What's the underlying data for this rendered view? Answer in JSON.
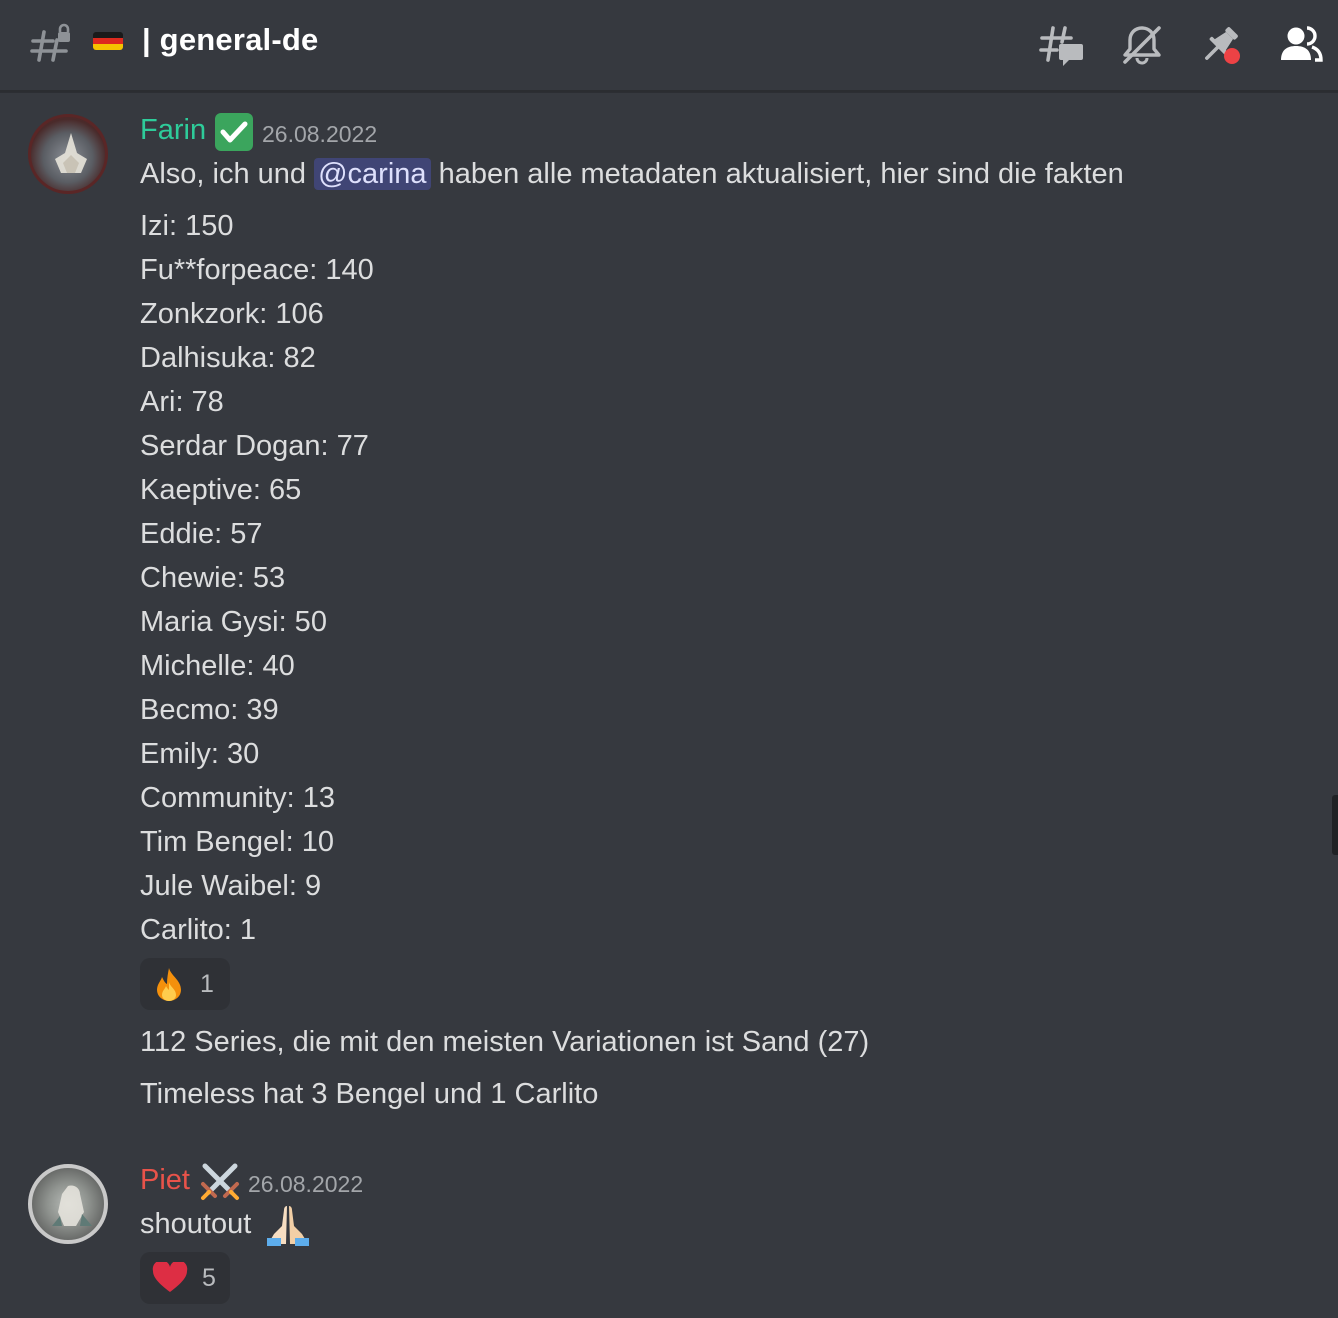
{
  "header": {
    "flag_icon": "germany-flag-icon",
    "channel_name": "| general-de",
    "icons": [
      "threads-icon",
      "mute-bell-icon",
      "pin-icon",
      "members-icon"
    ]
  },
  "messages": [
    {
      "username": "Farin",
      "username_color": "#2ecc9a",
      "badge_icon": "green-check-icon",
      "timestamp": "26.08.2022",
      "intro_before": "Also, ich und",
      "mention": "@carina",
      "intro_after": "haben alle metadaten aktualisiert, hier sind die fakten",
      "list": [
        "Izi: 150",
        "Fu**forpeace: 140",
        "Zonkzork: 106",
        "Dalhisuka: 82",
        "Ari: 78",
        "Serdar Dogan: 77",
        "Kaeptive: 65",
        "Eddie: 57",
        "Chewie: 53",
        "Maria Gysi: 50",
        "Michelle: 40",
        "Becmo: 39",
        "Emily: 30",
        "Community: 13",
        "Tim Bengel: 10",
        "Jule Waibel: 9",
        "Carlito: 1"
      ],
      "reaction": {
        "icon": "fire-icon",
        "count": "1"
      },
      "followups": [
        "112 Series, die mit den meisten Variationen ist Sand (27)",
        "Timeless hat 3 Bengel und 1 Carlito"
      ]
    },
    {
      "username": "Piet",
      "username_color": "#e8534a",
      "badge_icon": "crossed-swords-icon",
      "timestamp": "26.08.2022",
      "text": "shoutout",
      "text_emoji": "folded-hands-icon",
      "reaction": {
        "icon": "red-heart-icon",
        "count": "5"
      }
    }
  ]
}
